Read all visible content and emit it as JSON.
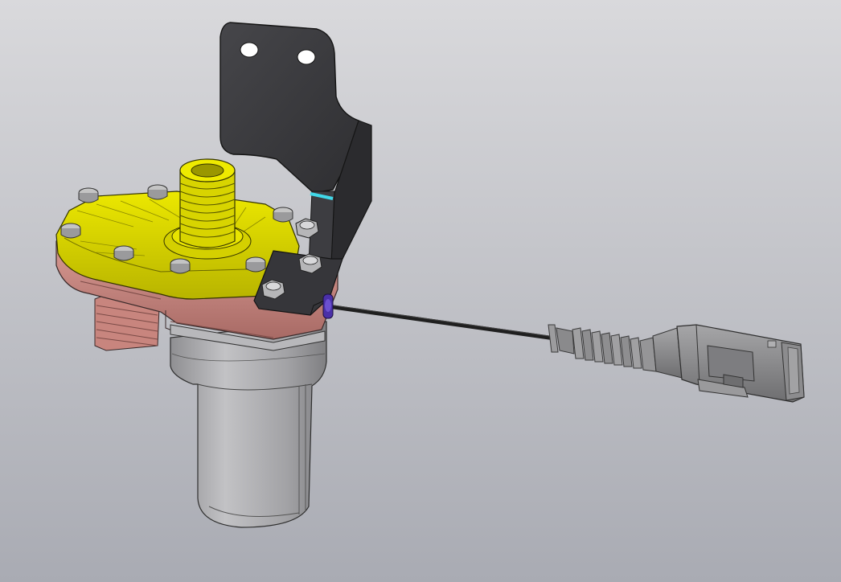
{
  "viewport": {
    "background_top": "#d9d9dc",
    "background_bottom": "#a9abb3"
  },
  "model": {
    "parts": [
      "mounting-bracket",
      "pump-cover",
      "inlet-nozzle",
      "pump-housing",
      "outlet-nozzle",
      "motor-body",
      "screws",
      "cable",
      "connector"
    ],
    "colors": {
      "bracket": "#3b3b3e",
      "cover": "#d8d400",
      "housing": "#c98a84",
      "motor": "#a5a5a8",
      "cable": "#252525",
      "connector": "#8e8e90",
      "screw": "#c4c4c4",
      "grommet": "#4a30a8",
      "highlight": "#40d8e8"
    }
  }
}
